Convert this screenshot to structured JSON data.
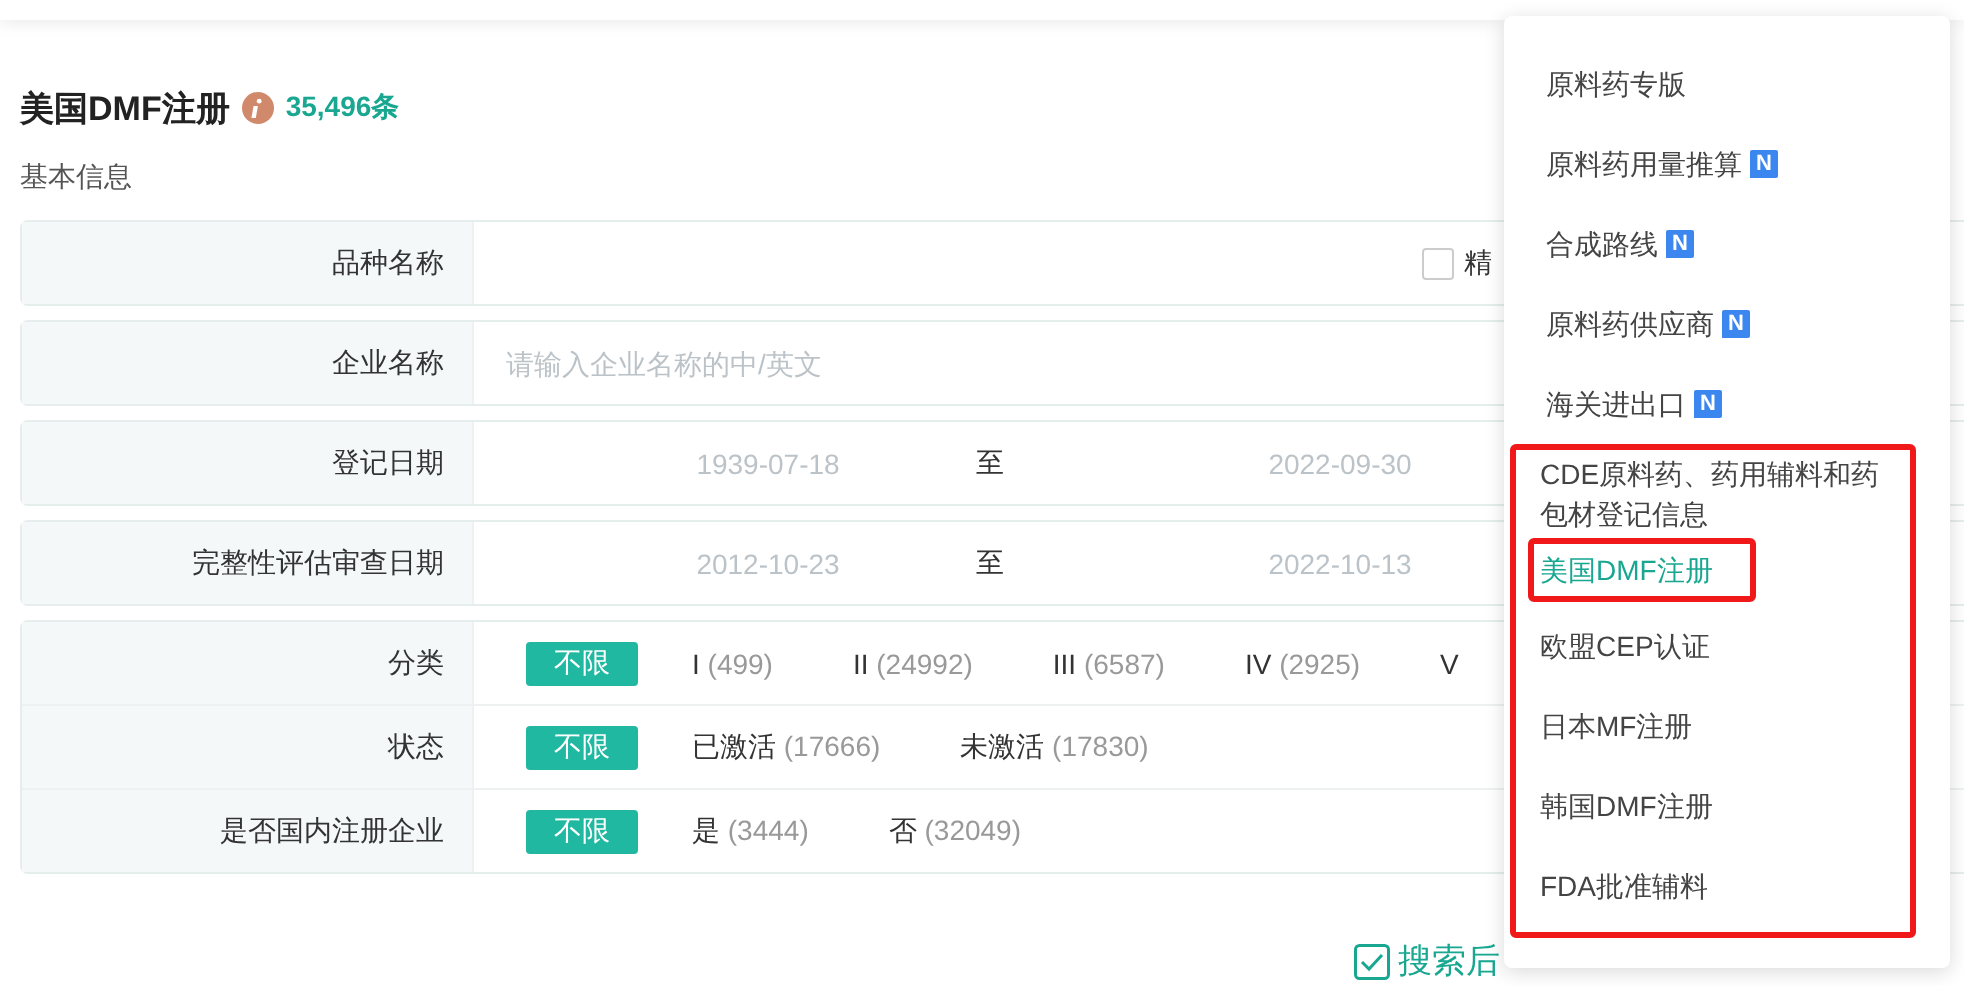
{
  "header": {
    "title": "美国DMF注册",
    "count": "35,496条"
  },
  "section_title": "基本信息",
  "fields": [
    {
      "kind": "text",
      "label": "品种名称",
      "checkbox": {
        "label": "精",
        "checked": false
      }
    },
    {
      "kind": "text",
      "label": "企业名称",
      "placeholder": "请输入企业名称的中/英文"
    },
    {
      "kind": "range",
      "label": "登记日期",
      "from_placeholder": "1939-07-18",
      "separator": "至",
      "to_placeholder": "2022-09-30"
    },
    {
      "kind": "range",
      "label": "完整性评估审查日期",
      "from_placeholder": "2012-10-23",
      "separator": "至",
      "to_placeholder": "2022-10-13"
    }
  ],
  "filters": [
    {
      "label": "分类",
      "options": [
        {
          "label": "不限",
          "selected": true
        },
        {
          "label": "I",
          "count": "(499)",
          "selected": false
        },
        {
          "label": "II",
          "count": "(24992)",
          "selected": false
        },
        {
          "label": "III",
          "count": "(6587)",
          "selected": false
        },
        {
          "label": "IV",
          "count": "(2925)",
          "selected": false
        },
        {
          "label": "V",
          "selected": false
        }
      ]
    },
    {
      "label": "状态",
      "options": [
        {
          "label": "不限",
          "selected": true
        },
        {
          "label": "已激活",
          "count": "(17666)",
          "selected": false
        },
        {
          "label": "未激活",
          "count": "(17830)",
          "selected": false
        }
      ]
    },
    {
      "label": "是否国内注册企业",
      "options": [
        {
          "label": "不限",
          "selected": true
        },
        {
          "label": "是",
          "count": "(3444)",
          "selected": false
        },
        {
          "label": "否",
          "count": "(32049)",
          "selected": false
        }
      ]
    }
  ],
  "search_after": {
    "label": "搜索后",
    "checked": true
  },
  "menu": {
    "sections": [
      {
        "items": [
          {
            "label": "原料药专版",
            "selected": false,
            "outlined": false
          },
          {
            "label": "原料药用量推算",
            "badge": "N",
            "selected": false,
            "outlined": false
          },
          {
            "label": "合成路线",
            "badge": "N",
            "selected": false,
            "outlined": false
          },
          {
            "label": "原料药供应商",
            "badge": "N",
            "selected": false,
            "outlined": false
          },
          {
            "label": "海关进出口",
            "badge": "N",
            "selected": false,
            "outlined": false
          }
        ]
      },
      {
        "outlined": true,
        "items": [
          {
            "label": "CDE原料药、药用辅料和药包材登记信息",
            "selected": false,
            "outlined": false
          },
          {
            "label": "美国DMF注册",
            "selected": true,
            "outlined": true
          },
          {
            "label": "欧盟CEP认证",
            "selected": false,
            "outlined": false
          },
          {
            "label": "日本MF注册",
            "selected": false,
            "outlined": false
          },
          {
            "label": "韩国DMF注册",
            "selected": false,
            "outlined": false
          },
          {
            "label": "FDA批准辅料",
            "selected": false,
            "outlined": false
          }
        ]
      }
    ]
  }
}
